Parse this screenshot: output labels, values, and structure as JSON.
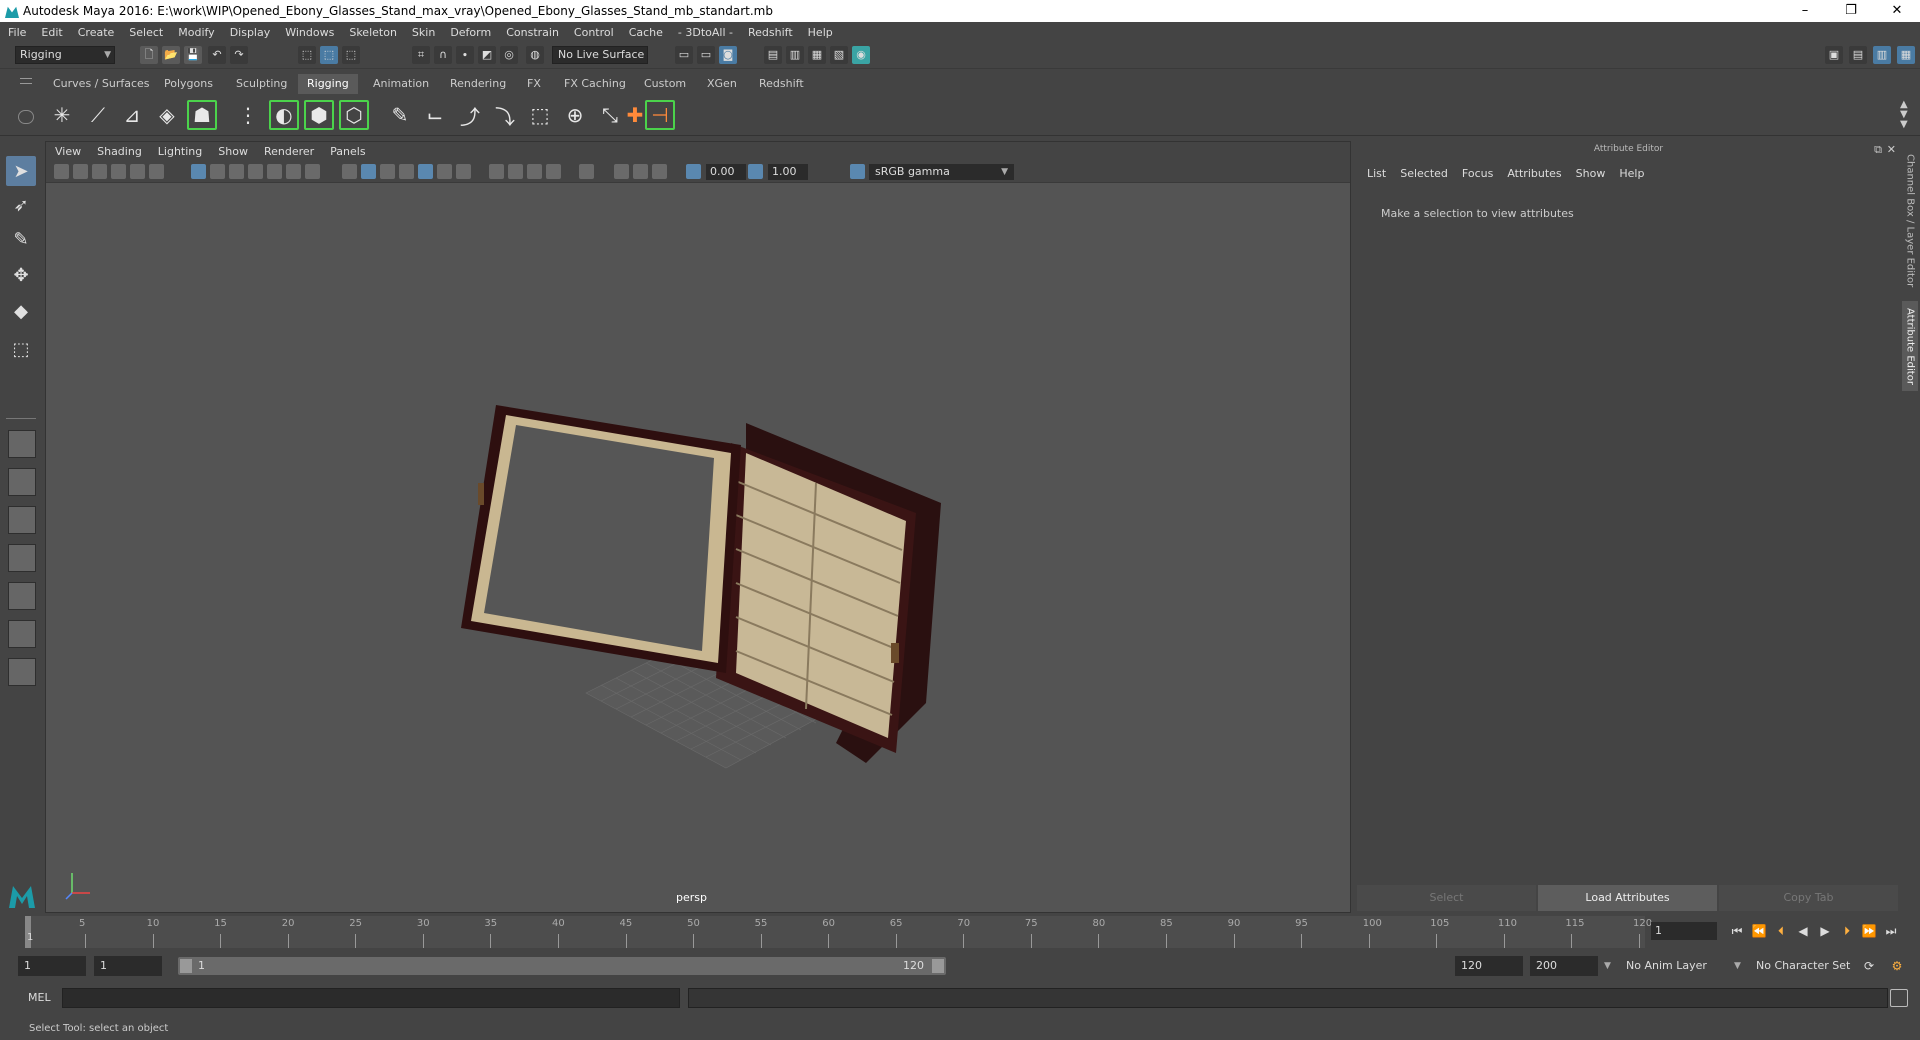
{
  "window": {
    "title": "Autodesk Maya 2016: E:\\work\\WIP\\Opened_Ebony_Glasses_Stand_max_vray\\Opened_Ebony_Glasses_Stand_mb_standart.mb",
    "minimize": "–",
    "maximize": "❐",
    "close": "✕"
  },
  "menubar": [
    "File",
    "Edit",
    "Create",
    "Select",
    "Modify",
    "Display",
    "Windows",
    "Skeleton",
    "Skin",
    "Deform",
    "Constrain",
    "Control",
    "Cache",
    "- 3DtoAll -",
    "Redshift",
    "Help"
  ],
  "statusline": {
    "mode": "Rigging",
    "live_surface": "No Live Surface"
  },
  "shelf": {
    "tabs": [
      "Curves / Surfaces",
      "Polygons",
      "Sculpting",
      "Rigging",
      "Animation",
      "Rendering",
      "FX",
      "FX Caching",
      "Custom",
      "XGen",
      "Redshift"
    ],
    "active_tab": "Rigging"
  },
  "viewport": {
    "menu": [
      "View",
      "Shading",
      "Lighting",
      "Show",
      "Renderer",
      "Panels"
    ],
    "exposure": "0.00",
    "gamma_value": "1.00",
    "color_space": "sRGB gamma",
    "camera": "persp"
  },
  "attribute_editor": {
    "title": "Attribute Editor",
    "menu": [
      "List",
      "Selected",
      "Focus",
      "Attributes",
      "Show",
      "Help"
    ],
    "message": "Make a selection to view attributes",
    "buttons": {
      "select": "Select",
      "load": "Load Attributes",
      "copy_tab": "Copy Tab"
    }
  },
  "side_tabs": {
    "channel_box": "Channel Box / Layer Editor",
    "attribute_editor": "Attribute Editor"
  },
  "timeslider": {
    "tick_labels": [
      "5",
      "10",
      "15",
      "20",
      "25",
      "30",
      "35",
      "40",
      "45",
      "50",
      "55",
      "60",
      "65",
      "70",
      "75",
      "80",
      "85",
      "90",
      "95",
      "100",
      "105",
      "110",
      "115",
      "120"
    ],
    "current_frame": "1",
    "current_frame_field": "1"
  },
  "rangeslider": {
    "start_time": "1",
    "playback_start": "1",
    "range_start_label": "1",
    "range_end_label": "120",
    "playback_end": "120",
    "end_time": "200",
    "anim_layer": "No Anim Layer",
    "character_set": "No Character Set"
  },
  "cmdline": {
    "label": "MEL"
  },
  "helpline": {
    "text": "Select Tool: select an object"
  },
  "colors": {
    "accent_blue": "#5d7ea0",
    "shelf_green": "#4bd34b",
    "maya_teal": "#1c9ba8"
  }
}
